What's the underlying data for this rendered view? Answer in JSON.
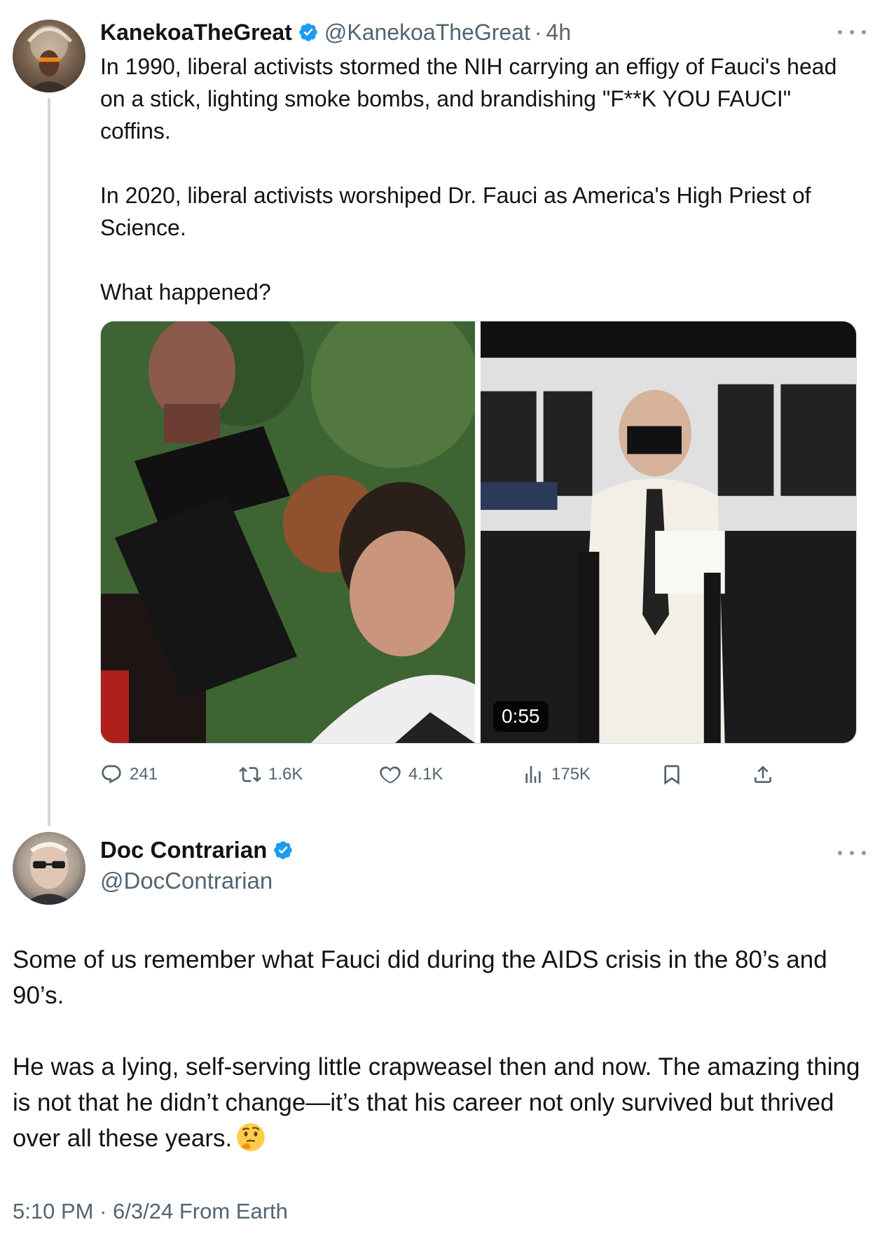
{
  "tweet_1": {
    "author": {
      "display_name": "KanekoaTheGreat",
      "handle": "@KanekoaTheGreat",
      "separator": "·",
      "time": "4h"
    },
    "paragraphs": [
      "In 1990, liberal activists stormed the NIH carrying an effigy of Fauci's head on a stick, lighting smoke bombs, and brandishing \"F**K YOU FAUCI\" coffins.",
      "In 2020, liberal activists worshiped Dr. Fauci as America's High Priest of Science.",
      "What happened?"
    ],
    "video_duration": "0:55",
    "stats": {
      "replies": "241",
      "reposts": "1.6K",
      "likes": "4.1K",
      "views": "175K"
    }
  },
  "tweet_2": {
    "author": {
      "display_name": "Doc Contrarian",
      "handle": "@DocContrarian"
    },
    "paragraphs": [
      "Some of us remember what Fauci did during the AIDS crisis in the 80’s and 90’s.",
      "He was a lying, self-serving little crapweasel then and now. The amazing thing is not that he didn’t change—it’s that his career not only survived but thrived over all these years."
    ],
    "emoji": "🤔",
    "footer": {
      "time": "5:10 PM",
      "separator": "·",
      "date": "6/3/24",
      "source": "From Earth"
    }
  },
  "colors": {
    "text_primary": "#0f1419",
    "text_secondary": "#536471",
    "verified_blue": "#1d9bf0",
    "thread_line": "#cfd9de"
  },
  "icons": [
    "verified-badge-icon",
    "more-icon",
    "reply-icon",
    "repost-icon",
    "like-icon",
    "views-icon",
    "bookmark-icon",
    "share-icon",
    "thinking-face-emoji"
  ]
}
